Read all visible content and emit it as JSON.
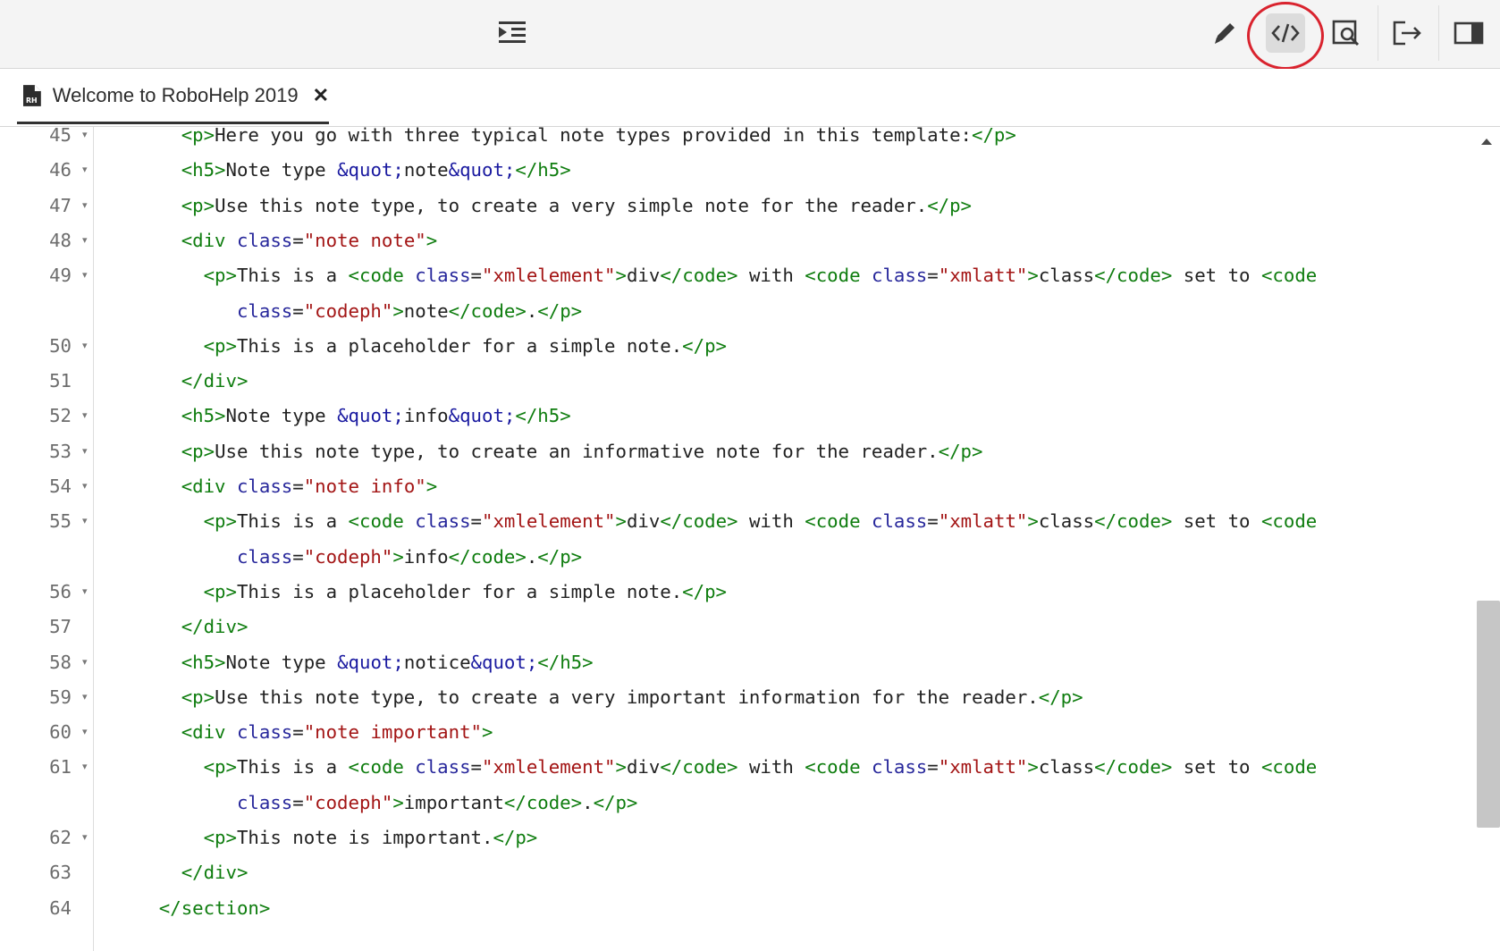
{
  "toolbar": {
    "buttons": [
      {
        "name": "indent-toggle",
        "icon": "indent-icon"
      },
      {
        "name": "author-mode",
        "icon": "pencil-icon"
      },
      {
        "name": "source-mode",
        "icon": "code-icon",
        "active": true
      },
      {
        "name": "preview",
        "icon": "preview-icon"
      },
      {
        "name": "export",
        "icon": "export-icon"
      },
      {
        "name": "properties-panel",
        "icon": "panel-icon"
      }
    ]
  },
  "tab": {
    "title": "Welcome to RoboHelp 2019",
    "close_label": "✕",
    "icon": "robohelp-file-icon"
  },
  "editor": {
    "lines": [
      {
        "num": "45",
        "fold": true,
        "indent": 3,
        "tokens": [
          [
            "tag",
            "<p>"
          ],
          [
            "text",
            "Here you go with three typical note types provided in this template:"
          ],
          [
            "tag",
            "</p>"
          ]
        ]
      },
      {
        "num": "46",
        "fold": true,
        "indent": 3,
        "tokens": [
          [
            "tag",
            "<h5>"
          ],
          [
            "text",
            "Note type "
          ],
          [
            "ent",
            "&quot;"
          ],
          [
            "text",
            "note"
          ],
          [
            "ent",
            "&quot;"
          ],
          [
            "tag",
            "</h5>"
          ]
        ]
      },
      {
        "num": "47",
        "fold": true,
        "indent": 3,
        "tokens": [
          [
            "tag",
            "<p>"
          ],
          [
            "text",
            "Use this note type, to create a very simple note for the reader."
          ],
          [
            "tag",
            "</p>"
          ]
        ]
      },
      {
        "num": "48",
        "fold": true,
        "indent": 3,
        "tokens": [
          [
            "tag",
            "<div "
          ],
          [
            "attr",
            "class"
          ],
          [
            "text",
            "="
          ],
          [
            "str",
            "\"note note\""
          ],
          [
            "tag",
            ">"
          ]
        ]
      },
      {
        "num": "49",
        "fold": true,
        "indent": 4,
        "tokens": [
          [
            "tag",
            "<p>"
          ],
          [
            "text",
            "This is a "
          ],
          [
            "tag",
            "<code "
          ],
          [
            "attr",
            "class"
          ],
          [
            "text",
            "="
          ],
          [
            "str",
            "\"xmlelement\""
          ],
          [
            "tag",
            ">"
          ],
          [
            "text",
            "div"
          ],
          [
            "tag",
            "</code>"
          ],
          [
            "text",
            " with "
          ],
          [
            "tag",
            "<code "
          ],
          [
            "attr",
            "class"
          ],
          [
            "text",
            "="
          ],
          [
            "str",
            "\"xmlatt\""
          ],
          [
            "tag",
            ">"
          ],
          [
            "text",
            "class"
          ],
          [
            "tag",
            "</code>"
          ],
          [
            "text",
            " set to "
          ],
          [
            "tag",
            "<code"
          ]
        ]
      },
      {
        "num": "",
        "fold": false,
        "indent": 5.5,
        "tokens": [
          [
            "attr",
            "class"
          ],
          [
            "text",
            "="
          ],
          [
            "str",
            "\"codeph\""
          ],
          [
            "tag",
            ">"
          ],
          [
            "text",
            "note"
          ],
          [
            "tag",
            "</code>"
          ],
          [
            "text",
            "."
          ],
          [
            "tag",
            "</p>"
          ]
        ]
      },
      {
        "num": "50",
        "fold": true,
        "indent": 4,
        "tokens": [
          [
            "tag",
            "<p>"
          ],
          [
            "text",
            "This is a placeholder for a simple note."
          ],
          [
            "tag",
            "</p>"
          ]
        ]
      },
      {
        "num": "51",
        "fold": false,
        "indent": 3,
        "tokens": [
          [
            "tag",
            "</div>"
          ]
        ]
      },
      {
        "num": "52",
        "fold": true,
        "indent": 3,
        "tokens": [
          [
            "tag",
            "<h5>"
          ],
          [
            "text",
            "Note type "
          ],
          [
            "ent",
            "&quot;"
          ],
          [
            "text",
            "info"
          ],
          [
            "ent",
            "&quot;"
          ],
          [
            "tag",
            "</h5>"
          ]
        ]
      },
      {
        "num": "53",
        "fold": true,
        "indent": 3,
        "tokens": [
          [
            "tag",
            "<p>"
          ],
          [
            "text",
            "Use this note type, to create an informative note for the reader."
          ],
          [
            "tag",
            "</p>"
          ]
        ]
      },
      {
        "num": "54",
        "fold": true,
        "indent": 3,
        "tokens": [
          [
            "tag",
            "<div "
          ],
          [
            "attr",
            "class"
          ],
          [
            "text",
            "="
          ],
          [
            "str",
            "\"note info\""
          ],
          [
            "tag",
            ">"
          ]
        ]
      },
      {
        "num": "55",
        "fold": true,
        "indent": 4,
        "tokens": [
          [
            "tag",
            "<p>"
          ],
          [
            "text",
            "This is a "
          ],
          [
            "tag",
            "<code "
          ],
          [
            "attr",
            "class"
          ],
          [
            "text",
            "="
          ],
          [
            "str",
            "\"xmlelement\""
          ],
          [
            "tag",
            ">"
          ],
          [
            "text",
            "div"
          ],
          [
            "tag",
            "</code>"
          ],
          [
            "text",
            " with "
          ],
          [
            "tag",
            "<code "
          ],
          [
            "attr",
            "class"
          ],
          [
            "text",
            "="
          ],
          [
            "str",
            "\"xmlatt\""
          ],
          [
            "tag",
            ">"
          ],
          [
            "text",
            "class"
          ],
          [
            "tag",
            "</code>"
          ],
          [
            "text",
            " set to "
          ],
          [
            "tag",
            "<code"
          ]
        ]
      },
      {
        "num": "",
        "fold": false,
        "indent": 5.5,
        "tokens": [
          [
            "attr",
            "class"
          ],
          [
            "text",
            "="
          ],
          [
            "str",
            "\"codeph\""
          ],
          [
            "tag",
            ">"
          ],
          [
            "text",
            "info"
          ],
          [
            "tag",
            "</code>"
          ],
          [
            "text",
            "."
          ],
          [
            "tag",
            "</p>"
          ]
        ]
      },
      {
        "num": "56",
        "fold": true,
        "indent": 4,
        "tokens": [
          [
            "tag",
            "<p>"
          ],
          [
            "text",
            "This is a placeholder for a simple note."
          ],
          [
            "tag",
            "</p>"
          ]
        ]
      },
      {
        "num": "57",
        "fold": false,
        "indent": 3,
        "tokens": [
          [
            "tag",
            "</div>"
          ]
        ]
      },
      {
        "num": "58",
        "fold": true,
        "indent": 3,
        "tokens": [
          [
            "tag",
            "<h5>"
          ],
          [
            "text",
            "Note type "
          ],
          [
            "ent",
            "&quot;"
          ],
          [
            "text",
            "notice"
          ],
          [
            "ent",
            "&quot;"
          ],
          [
            "tag",
            "</h5>"
          ]
        ]
      },
      {
        "num": "59",
        "fold": true,
        "indent": 3,
        "tokens": [
          [
            "tag",
            "<p>"
          ],
          [
            "text",
            "Use this note type, to create a very important information for the reader."
          ],
          [
            "tag",
            "</p>"
          ]
        ]
      },
      {
        "num": "60",
        "fold": true,
        "indent": 3,
        "tokens": [
          [
            "tag",
            "<div "
          ],
          [
            "attr",
            "class"
          ],
          [
            "text",
            "="
          ],
          [
            "str",
            "\"note important\""
          ],
          [
            "tag",
            ">"
          ]
        ]
      },
      {
        "num": "61",
        "fold": true,
        "indent": 4,
        "tokens": [
          [
            "tag",
            "<p>"
          ],
          [
            "text",
            "This is a "
          ],
          [
            "tag",
            "<code "
          ],
          [
            "attr",
            "class"
          ],
          [
            "text",
            "="
          ],
          [
            "str",
            "\"xmlelement\""
          ],
          [
            "tag",
            ">"
          ],
          [
            "text",
            "div"
          ],
          [
            "tag",
            "</code>"
          ],
          [
            "text",
            " with "
          ],
          [
            "tag",
            "<code "
          ],
          [
            "attr",
            "class"
          ],
          [
            "text",
            "="
          ],
          [
            "str",
            "\"xmlatt\""
          ],
          [
            "tag",
            ">"
          ],
          [
            "text",
            "class"
          ],
          [
            "tag",
            "</code>"
          ],
          [
            "text",
            " set to "
          ],
          [
            "tag",
            "<code"
          ]
        ]
      },
      {
        "num": "",
        "fold": false,
        "indent": 5.5,
        "tokens": [
          [
            "attr",
            "class"
          ],
          [
            "text",
            "="
          ],
          [
            "str",
            "\"codeph\""
          ],
          [
            "tag",
            ">"
          ],
          [
            "text",
            "important"
          ],
          [
            "tag",
            "</code>"
          ],
          [
            "text",
            "."
          ],
          [
            "tag",
            "</p>"
          ]
        ]
      },
      {
        "num": "62",
        "fold": true,
        "indent": 4,
        "tokens": [
          [
            "tag",
            "<p>"
          ],
          [
            "text",
            "This note is important."
          ],
          [
            "tag",
            "</p>"
          ]
        ]
      },
      {
        "num": "63",
        "fold": false,
        "indent": 3,
        "tokens": [
          [
            "tag",
            "</div>"
          ]
        ]
      },
      {
        "num": "64",
        "fold": false,
        "indent": 2,
        "tokens": [
          [
            "tag",
            "</section>"
          ]
        ]
      }
    ]
  }
}
